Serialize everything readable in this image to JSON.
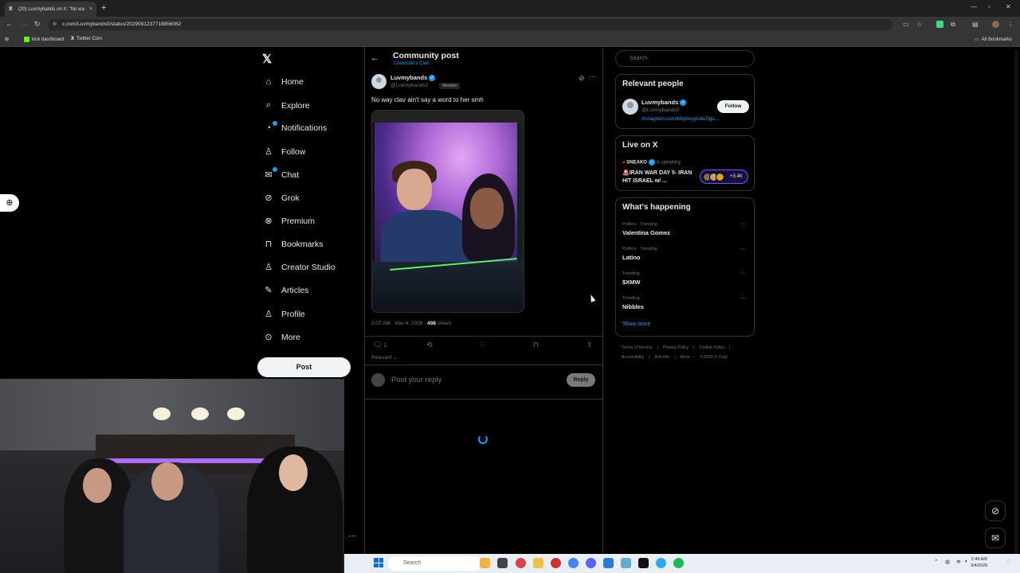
{
  "browser": {
    "tab_title": "(20) Luvmybands on X: \"No wa",
    "tab_close": "×",
    "new_tab": "+",
    "url": "x.com/Luvmybands0/status/2029091237718856082",
    "bookmarks": [
      {
        "label": "kick dashboard",
        "color": "#53fc18"
      },
      {
        "label": "Twitter Com",
        "color": "#ffffff"
      }
    ],
    "all_bookmarks": "All Bookmarks"
  },
  "nav": {
    "logo": "𝕏",
    "items": [
      {
        "label": "Home",
        "icon": "home-icon",
        "glyph": "⌂"
      },
      {
        "label": "Explore",
        "icon": "search-icon",
        "glyph": "⌕"
      },
      {
        "label": "Notifications",
        "icon": "bell-icon",
        "glyph": "🔔"
      },
      {
        "label": "Follow",
        "icon": "person-plus-icon",
        "glyph": "👤"
      },
      {
        "label": "Chat",
        "icon": "envelope-icon",
        "glyph": "✉"
      },
      {
        "label": "Grok",
        "icon": "grok-icon",
        "glyph": "⊘"
      },
      {
        "label": "Premium",
        "icon": "premium-icon",
        "glyph": "⊗"
      },
      {
        "label": "Bookmarks",
        "icon": "bookmark-icon",
        "glyph": "🔖"
      },
      {
        "label": "Creator Studio",
        "icon": "creator-studio-icon",
        "glyph": "♙"
      },
      {
        "label": "Articles",
        "icon": "articles-icon",
        "glyph": "✎"
      },
      {
        "label": "Profile",
        "icon": "profile-icon",
        "glyph": "👤"
      },
      {
        "label": "More",
        "icon": "more-circle-icon",
        "glyph": "⊙"
      }
    ],
    "post_label": "Post"
  },
  "main": {
    "title": "Community post",
    "subtitle": "Clavicular's Clan",
    "author": {
      "name": "Luvmybands",
      "handle": "@Luvmybands0",
      "badge": "Member"
    },
    "text": "No way clav ain't say a word to her smh",
    "meta_time": "2:07 AM · Mar 4, 2026 · ",
    "views_count": "498",
    "views_label": " Views",
    "actions": {
      "reply_count": "2"
    },
    "sort_label": "Relevant",
    "reply_placeholder": "Post your reply",
    "reply_button": "Reply"
  },
  "right": {
    "search_placeholder": "Search",
    "relevant_people": {
      "title": "Relevant people",
      "name": "Luvmybands",
      "handle": "@Luvmybands0",
      "link": "Instagram.com/bbyboyyoda7lgs...",
      "follow": "Follow"
    },
    "live": {
      "title": "Live on X",
      "host": "SNEAKO",
      "status": "is speaking",
      "stream_title": "🚨IRAN WAR DAY 5- IRAN HIT ISRAEL w/ ...",
      "listeners": "+3.4K"
    },
    "happening": {
      "title": "What's happening",
      "trends": [
        {
          "meta": "Politics · Trending",
          "name": "Valentina Gomez"
        },
        {
          "meta": "Politics · Trending",
          "name": "Latino"
        },
        {
          "meta": "Trending",
          "name": "$XMW"
        },
        {
          "meta": "Trending",
          "name": "Nibbles"
        }
      ],
      "show_more": "Show more"
    },
    "footer": [
      "Terms of Service",
      "|",
      "Privacy Policy",
      "|",
      "Cookie Policy",
      "|",
      "Accessibility",
      "|",
      "Ads info",
      "|",
      "More ···",
      "© 2026 X Corp."
    ]
  },
  "taskbar": {
    "search": "Search",
    "time": "2:49 AM",
    "date": "3/4/2026"
  },
  "colors": {
    "accent": "#1d9bf0",
    "background": "#000000",
    "live_pill": "#7856ff"
  }
}
